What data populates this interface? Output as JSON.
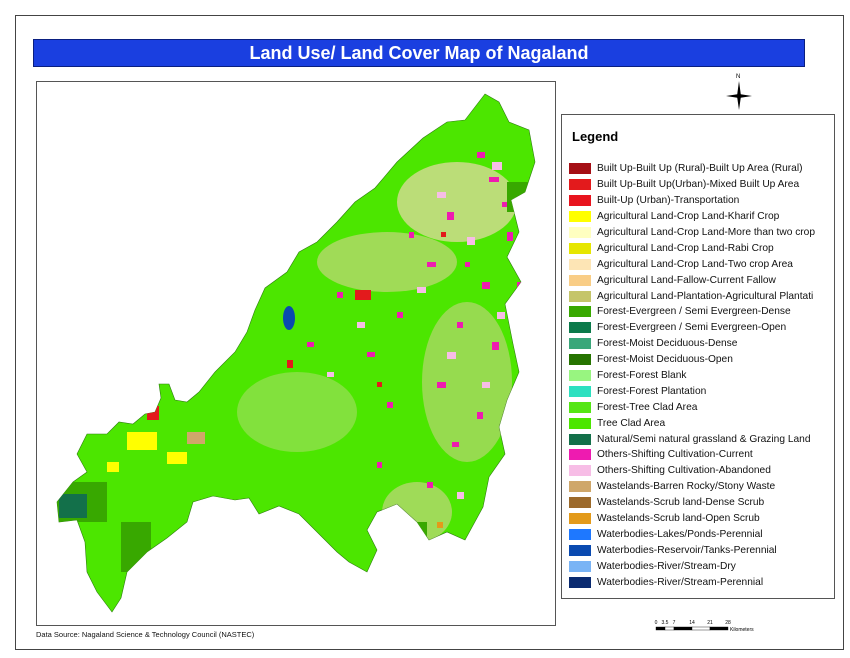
{
  "map": {
    "title": "Land Use/ Land Cover Map of Nagaland",
    "north_label": "N",
    "data_source": "Data Source: Nagaland Science & Technology Council (NASTEC)",
    "scale": {
      "ticks": [
        "0",
        "3.5",
        "7",
        "14",
        "21",
        "28"
      ],
      "unit": "Kilometers"
    },
    "legend_title": "Legend",
    "legend": [
      {
        "label": "Built Up-Built Up (Rural)-Built Up Area (Rural)",
        "color": "#a50f15"
      },
      {
        "label": "Built Up-Built Up(Urban)-Mixed Built Up Area",
        "color": "#e31a1c"
      },
      {
        "label": "Built-Up (Urban)-Transportation",
        "color": "#e8141e"
      },
      {
        "label": "Agricultural Land-Crop Land-Kharif Crop",
        "color": "#ffff00"
      },
      {
        "label": "Agricultural Land-Crop Land-More than two crop",
        "color": "#ffffc0"
      },
      {
        "label": "Agricultural Land-Crop Land-Rabi Crop",
        "color": "#e6e600"
      },
      {
        "label": "Agricultural Land-Crop Land-Two crop Area",
        "color": "#fde5b5"
      },
      {
        "label": "Agricultural Land-Fallow-Current Fallow",
        "color": "#f9cd86"
      },
      {
        "label": "Agricultural Land-Plantation-Agricultural Plantati",
        "color": "#c5c56a"
      },
      {
        "label": "Forest-Evergreen / Semi Evergreen-Dense",
        "color": "#38a800"
      },
      {
        "label": "Forest-Evergreen / Semi Evergreen-Open",
        "color": "#0b7a4a"
      },
      {
        "label": "Forest-Moist Deciduous-Dense",
        "color": "#3aa77a"
      },
      {
        "label": "Forest-Moist Deciduous-Open",
        "color": "#267300"
      },
      {
        "label": "Forest-Forest Blank",
        "color": "#98f580"
      },
      {
        "label": "Forest-Forest Plantation",
        "color": "#2de0c0"
      },
      {
        "label": "Forest-Tree Clad Area",
        "color": "#55e615"
      },
      {
        "label": "Tree Clad Area",
        "color": "#4ce600"
      },
      {
        "label": "Natural/Semi natural grassland & Grazing Land",
        "color": "#13704a"
      },
      {
        "label": "Others-Shifting Cultivation-Current",
        "color": "#ee1bb0"
      },
      {
        "label": "Others-Shifting Cultivation-Abandoned",
        "color": "#f7bde6"
      },
      {
        "label": "Wastelands-Barren Rocky/Stony Waste",
        "color": "#cfa76a"
      },
      {
        "label": "Wastelands-Scrub land-Dense Scrub",
        "color": "#9c6a2b"
      },
      {
        "label": "Wastelands-Scrub land-Open Scrub",
        "color": "#e39a1a"
      },
      {
        "label": "Waterbodies-Lakes/Ponds-Perennial",
        "color": "#1e78ff"
      },
      {
        "label": "Waterbodies-Reservoir/Tanks-Perennial",
        "color": "#0a4ab0"
      },
      {
        "label": "Waterbodies-River/Stream-Dry",
        "color": "#7ab4f5"
      },
      {
        "label": "Waterbodies-River/Stream-Perennial",
        "color": "#0a2a70"
      }
    ]
  }
}
